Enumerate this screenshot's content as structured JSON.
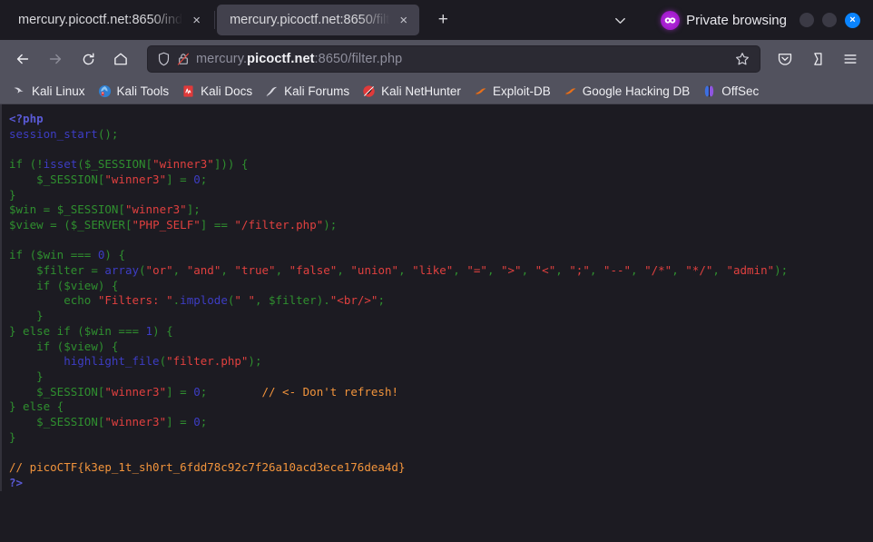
{
  "browser": {
    "tabs": [
      {
        "title": "mercury.picoctf.net:8650/ind",
        "active": false,
        "close_label": "×"
      },
      {
        "title": "mercury.picoctf.net:8650/filt",
        "active": true,
        "close_label": "×"
      }
    ],
    "new_tab_label": "+",
    "private_browsing_label": "Private browsing",
    "window_close_label": "×",
    "toolbar": {
      "url_prefix": "mercury.",
      "url_domain": "picoctf.net",
      "url_suffix": ":8650/filter.php",
      "url_full": "mercury.picoctf.net:8650/filter.php"
    },
    "bookmarks": [
      {
        "label": "Kali Linux",
        "icon": "kali-dragon-icon"
      },
      {
        "label": "Kali Tools",
        "icon": "kali-tools-icon"
      },
      {
        "label": "Kali Docs",
        "icon": "kali-docs-icon"
      },
      {
        "label": "Kali Forums",
        "icon": "kali-forums-icon"
      },
      {
        "label": "Kali NetHunter",
        "icon": "kali-nethunter-icon"
      },
      {
        "label": "Exploit-DB",
        "icon": "exploit-db-icon"
      },
      {
        "label": "Google Hacking DB",
        "icon": "google-hacking-db-icon"
      },
      {
        "label": "OffSec",
        "icon": "offsec-icon"
      }
    ]
  },
  "page": {
    "code_lines": [
      [
        {
          "t": "<?php",
          "c": "tag"
        }
      ],
      [
        {
          "t": "session_start",
          "c": "fn"
        },
        {
          "t": "();",
          "c": "kw"
        }
      ],
      [
        {
          "t": "",
          "c": "kw"
        }
      ],
      [
        {
          "t": "if (!",
          "c": "kw"
        },
        {
          "t": "isset",
          "c": "fn"
        },
        {
          "t": "(",
          "c": "kw"
        },
        {
          "t": "$_SESSION",
          "c": "def"
        },
        {
          "t": "[",
          "c": "kw"
        },
        {
          "t": "\"winner3\"",
          "c": "str"
        },
        {
          "t": "])) {",
          "c": "kw"
        }
      ],
      [
        {
          "t": "    ",
          "c": "kw"
        },
        {
          "t": "$_SESSION",
          "c": "def"
        },
        {
          "t": "[",
          "c": "kw"
        },
        {
          "t": "\"winner3\"",
          "c": "str"
        },
        {
          "t": "] = ",
          "c": "kw"
        },
        {
          "t": "0",
          "c": "fn"
        },
        {
          "t": ";",
          "c": "kw"
        }
      ],
      [
        {
          "t": "}",
          "c": "kw"
        }
      ],
      [
        {
          "t": "$win",
          "c": "def"
        },
        {
          "t": " = ",
          "c": "kw"
        },
        {
          "t": "$_SESSION",
          "c": "def"
        },
        {
          "t": "[",
          "c": "kw"
        },
        {
          "t": "\"winner3\"",
          "c": "str"
        },
        {
          "t": "];",
          "c": "kw"
        }
      ],
      [
        {
          "t": "$view",
          "c": "def"
        },
        {
          "t": " = (",
          "c": "kw"
        },
        {
          "t": "$_SERVER",
          "c": "def"
        },
        {
          "t": "[",
          "c": "kw"
        },
        {
          "t": "\"PHP_SELF\"",
          "c": "str"
        },
        {
          "t": "] == ",
          "c": "kw"
        },
        {
          "t": "\"/filter.php\"",
          "c": "str"
        },
        {
          "t": ");",
          "c": "kw"
        }
      ],
      [
        {
          "t": "",
          "c": "kw"
        }
      ],
      [
        {
          "t": "if (",
          "c": "kw"
        },
        {
          "t": "$win",
          "c": "def"
        },
        {
          "t": " === ",
          "c": "kw"
        },
        {
          "t": "0",
          "c": "fn"
        },
        {
          "t": ") {",
          "c": "kw"
        }
      ],
      [
        {
          "t": "    ",
          "c": "kw"
        },
        {
          "t": "$filter",
          "c": "def"
        },
        {
          "t": " = ",
          "c": "kw"
        },
        {
          "t": "array",
          "c": "fn"
        },
        {
          "t": "(",
          "c": "kw"
        },
        {
          "t": "\"or\"",
          "c": "str"
        },
        {
          "t": ", ",
          "c": "kw"
        },
        {
          "t": "\"and\"",
          "c": "str"
        },
        {
          "t": ", ",
          "c": "kw"
        },
        {
          "t": "\"true\"",
          "c": "str"
        },
        {
          "t": ", ",
          "c": "kw"
        },
        {
          "t": "\"false\"",
          "c": "str"
        },
        {
          "t": ", ",
          "c": "kw"
        },
        {
          "t": "\"union\"",
          "c": "str"
        },
        {
          "t": ", ",
          "c": "kw"
        },
        {
          "t": "\"like\"",
          "c": "str"
        },
        {
          "t": ", ",
          "c": "kw"
        },
        {
          "t": "\"=\"",
          "c": "str"
        },
        {
          "t": ", ",
          "c": "kw"
        },
        {
          "t": "\">\"",
          "c": "str"
        },
        {
          "t": ", ",
          "c": "kw"
        },
        {
          "t": "\"<\"",
          "c": "str"
        },
        {
          "t": ", ",
          "c": "kw"
        },
        {
          "t": "\";\"",
          "c": "str"
        },
        {
          "t": ", ",
          "c": "kw"
        },
        {
          "t": "\"--\"",
          "c": "str"
        },
        {
          "t": ", ",
          "c": "kw"
        },
        {
          "t": "\"/*\"",
          "c": "str"
        },
        {
          "t": ", ",
          "c": "kw"
        },
        {
          "t": "\"*/\"",
          "c": "str"
        },
        {
          "t": ", ",
          "c": "kw"
        },
        {
          "t": "\"admin\"",
          "c": "str"
        },
        {
          "t": ");",
          "c": "kw"
        }
      ],
      [
        {
          "t": "    if (",
          "c": "kw"
        },
        {
          "t": "$view",
          "c": "def"
        },
        {
          "t": ") {",
          "c": "kw"
        }
      ],
      [
        {
          "t": "        echo ",
          "c": "kw"
        },
        {
          "t": "\"Filters: \"",
          "c": "str"
        },
        {
          "t": ".",
          "c": "kw"
        },
        {
          "t": "implode",
          "c": "fn"
        },
        {
          "t": "(",
          "c": "kw"
        },
        {
          "t": "\" \"",
          "c": "str"
        },
        {
          "t": ", ",
          "c": "kw"
        },
        {
          "t": "$filter",
          "c": "def"
        },
        {
          "t": ").",
          "c": "kw"
        },
        {
          "t": "\"<br/>\"",
          "c": "str"
        },
        {
          "t": ";",
          "c": "kw"
        }
      ],
      [
        {
          "t": "    }",
          "c": "kw"
        }
      ],
      [
        {
          "t": "} else if (",
          "c": "kw"
        },
        {
          "t": "$win",
          "c": "def"
        },
        {
          "t": " === ",
          "c": "kw"
        },
        {
          "t": "1",
          "c": "fn"
        },
        {
          "t": ") {",
          "c": "kw"
        }
      ],
      [
        {
          "t": "    if (",
          "c": "kw"
        },
        {
          "t": "$view",
          "c": "def"
        },
        {
          "t": ") {",
          "c": "kw"
        }
      ],
      [
        {
          "t": "        ",
          "c": "kw"
        },
        {
          "t": "highlight_file",
          "c": "fn"
        },
        {
          "t": "(",
          "c": "kw"
        },
        {
          "t": "\"filter.php\"",
          "c": "str"
        },
        {
          "t": ");",
          "c": "kw"
        }
      ],
      [
        {
          "t": "    }",
          "c": "kw"
        }
      ],
      [
        {
          "t": "    ",
          "c": "kw"
        },
        {
          "t": "$_SESSION",
          "c": "def"
        },
        {
          "t": "[",
          "c": "kw"
        },
        {
          "t": "\"winner3\"",
          "c": "str"
        },
        {
          "t": "] = ",
          "c": "kw"
        },
        {
          "t": "0",
          "c": "fn"
        },
        {
          "t": ";        ",
          "c": "kw"
        },
        {
          "t": "// <- Don't refresh!",
          "c": "cmt"
        }
      ],
      [
        {
          "t": "} else {",
          "c": "kw"
        }
      ],
      [
        {
          "t": "    ",
          "c": "kw"
        },
        {
          "t": "$_SESSION",
          "c": "def"
        },
        {
          "t": "[",
          "c": "kw"
        },
        {
          "t": "\"winner3\"",
          "c": "str"
        },
        {
          "t": "] = ",
          "c": "kw"
        },
        {
          "t": "0",
          "c": "fn"
        },
        {
          "t": ";",
          "c": "kw"
        }
      ],
      [
        {
          "t": "}",
          "c": "kw"
        }
      ],
      [
        {
          "t": "",
          "c": "kw"
        }
      ],
      [
        {
          "t": "// picoCTF{k3ep_1t_sh0rt_6fdd78c92c7f26a10acd3ece176dea4d}",
          "c": "cmt"
        }
      ],
      [
        {
          "t": "?>",
          "c": "tag"
        }
      ]
    ],
    "flag": "picoCTF{k3ep_1t_sh0rt_6fdd78c92c7f26a10acd3ece176dea4d}"
  },
  "colors": {
    "chrome_bg": "#1c1b22",
    "toolbar_bg": "#52525e",
    "urlbar_bg": "#2b2a33",
    "active_tab_bg": "#42414d",
    "accent_private": "#b833e1",
    "close_blue": "#0a84ff",
    "code_string": "#e0403f",
    "code_keyword": "#2f8f2f",
    "code_function": "#3d3dc4",
    "code_comment": "#f2943c",
    "code_tag": "#5a5ad6"
  }
}
